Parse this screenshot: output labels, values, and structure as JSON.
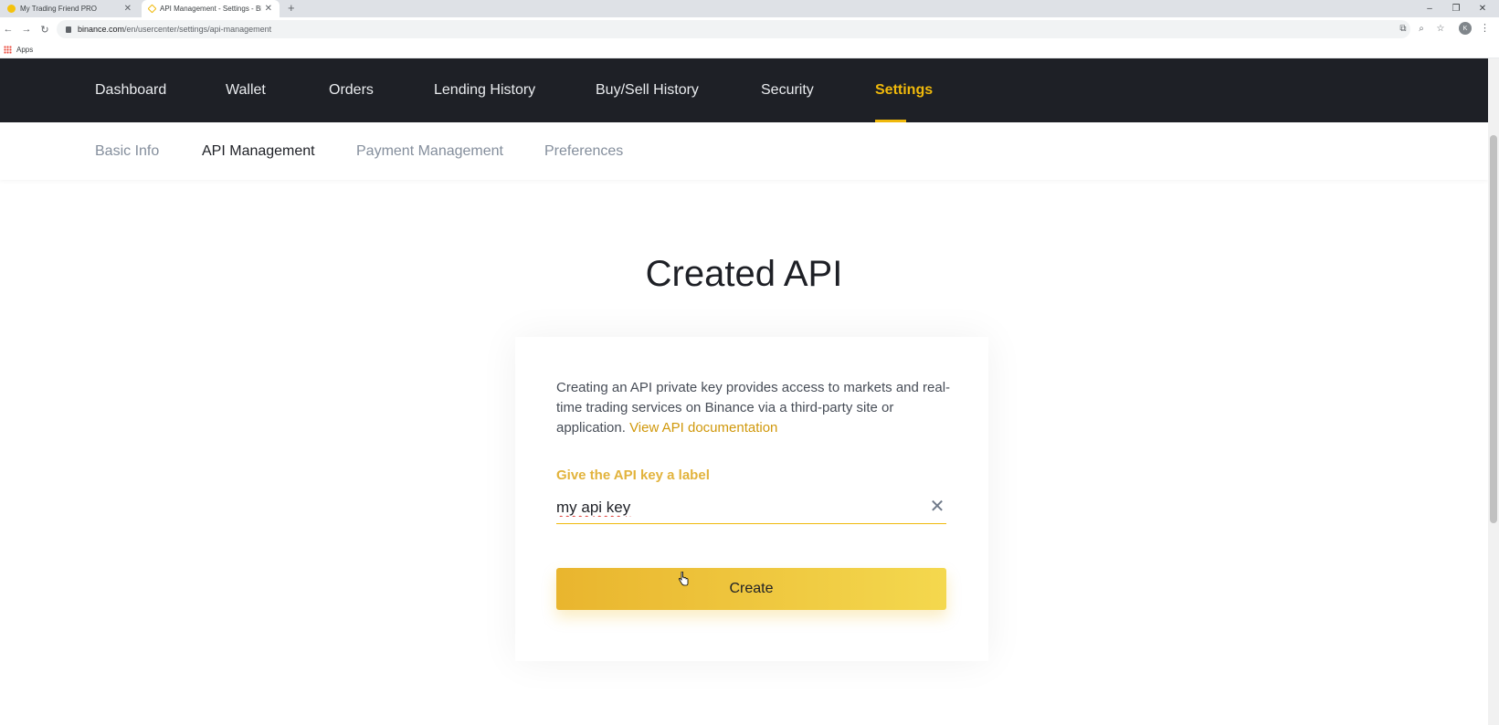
{
  "browser": {
    "tabs": [
      {
        "title": "My Trading Friend PRO",
        "active": false
      },
      {
        "title": "API Management - Settings - Bin",
        "active": true
      }
    ],
    "new_tab": "+",
    "url_host": "binance.com",
    "url_path": "/en/usercenter/settings/api-management",
    "profile_initial": "K",
    "bookmarks_apps": "Apps"
  },
  "topnav": {
    "items": [
      "Dashboard",
      "Wallet",
      "Orders",
      "Lending History",
      "Buy/Sell History",
      "Security",
      "Settings"
    ],
    "active": "Settings"
  },
  "subnav": {
    "items": [
      "Basic Info",
      "API Management",
      "Payment Management",
      "Preferences"
    ],
    "active": "API Management"
  },
  "page": {
    "title": "Created API",
    "description": "Creating an API private key provides access to markets and real-time trading services on Binance via a third-party site or application.",
    "doc_link": "View API documentation",
    "field_label": "Give the API key a label",
    "field_value": "my api key",
    "create_button": "Create"
  },
  "colors": {
    "accent": "#f0b90b",
    "nav_bg": "#1e2026"
  }
}
